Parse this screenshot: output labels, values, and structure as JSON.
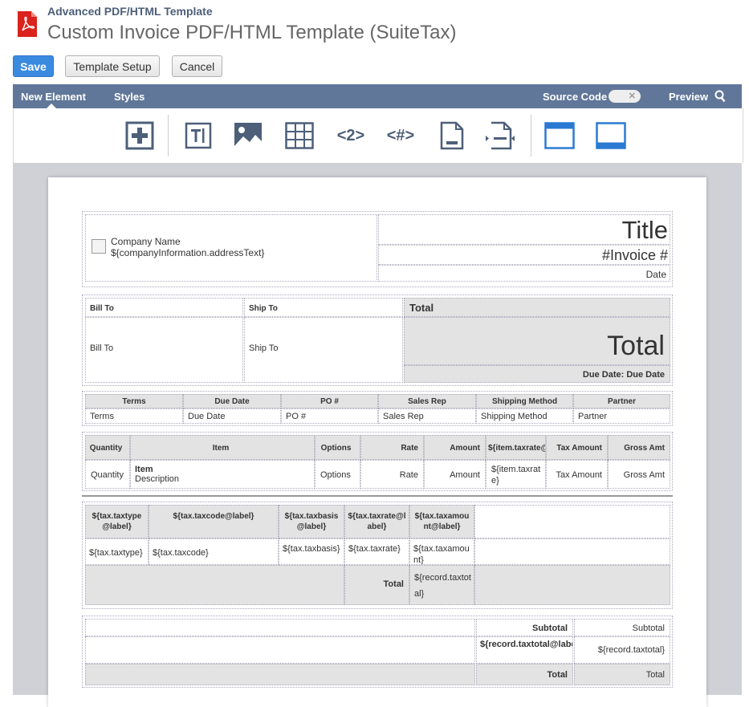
{
  "header": {
    "breadcrumb": "Advanced PDF/HTML Template",
    "title": "Custom Invoice PDF/HTML Template (SuiteTax)",
    "buttons": {
      "save": "Save",
      "setup": "Template Setup",
      "cancel": "Cancel"
    }
  },
  "toolbar": {
    "new_element": "New Element",
    "styles": "Styles",
    "source_code": "Source Code",
    "preview": "Preview",
    "icons": [
      "add-element-icon",
      "text-icon",
      "image-icon",
      "table-icon",
      "number-field-icon",
      "hash-field-icon",
      "page-footer-icon",
      "page-break-icon",
      "header-layout-icon",
      "footer-layout-icon"
    ],
    "tool_text": {
      "number": "<2>",
      "hash": "<#>"
    }
  },
  "doc": {
    "company_name": "Company Name",
    "company_address": "${companyInformation.addressText}",
    "title": "Title",
    "invoice_no": "#Invoice #",
    "date": "Date",
    "bill_to_hd": "Bill To",
    "ship_to_hd": "Ship To",
    "total_hd": "Total",
    "bill_to": "Bill To",
    "ship_to": "Ship To",
    "total_big": "Total",
    "due_date": "Due Date: Due Date",
    "terms_hd": [
      "Terms",
      "Due Date",
      "PO #",
      "Sales Rep",
      "Shipping Method",
      "Partner"
    ],
    "terms_val": [
      "Terms",
      "Due Date",
      "PO #",
      "Sales Rep",
      "Shipping Method",
      "Partner"
    ],
    "items_hd": [
      "Quantity",
      "Item",
      "Options",
      "Rate",
      "Amount",
      "${item.taxrate@label}",
      "Tax Amount",
      "Gross Amt"
    ],
    "items_val": {
      "quantity": "Quantity",
      "item": "Item",
      "description": "Description",
      "options": "Options",
      "rate": "Rate",
      "amount": "Amount",
      "taxrate": "${item.taxrate}",
      "taxamount": "Tax Amount",
      "gross": "Gross Amt"
    },
    "tax_hd": [
      "${tax.taxtype@label}",
      "${tax.taxcode@label}",
      "${tax.taxbasis@label}",
      "${tax.taxrate@label}",
      "${tax.taxamount@label}"
    ],
    "tax_val": [
      "${tax.taxtype}",
      "${tax.taxcode}",
      "${tax.taxbasis}",
      "${tax.taxrate}",
      "${tax.taxamount}"
    ],
    "tax_total_label": "Total",
    "tax_total_val": "${record.taxtotal}",
    "sum": {
      "subtotal_label": "Subtotal",
      "subtotal_val": "Subtotal",
      "taxtotal_label": "${record.taxtotal@label}",
      "taxtotal_val": "${record.taxtotal}",
      "total_label": "Total",
      "total_val": "Total"
    }
  }
}
